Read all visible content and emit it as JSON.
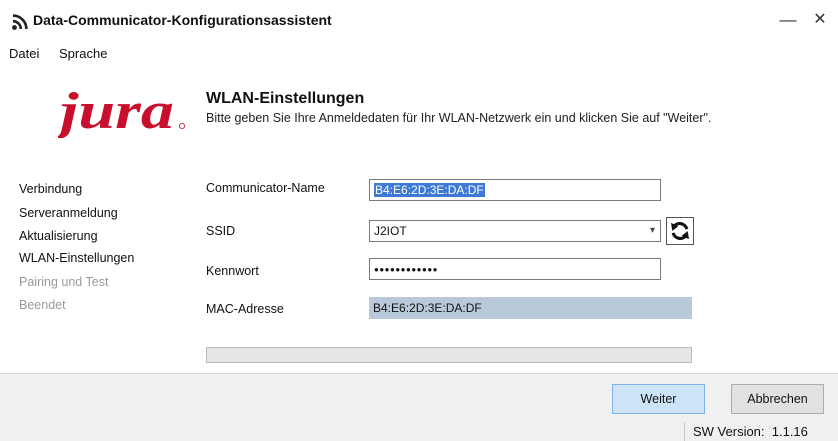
{
  "window": {
    "title": "Data-Communicator-Konfigurationsassistent",
    "minimize_glyph": "—",
    "close_glyph": "✕"
  },
  "menu": {
    "items": [
      {
        "label": "Datei"
      },
      {
        "label": "Sprache"
      }
    ]
  },
  "logo": {
    "text": "jura",
    "color": "#c8102e"
  },
  "header": {
    "title": "WLAN-Einstellungen",
    "subtitle": "Bitte geben Sie Ihre Anmeldedaten für Ihr WLAN-Netzwerk ein und klicken Sie auf \"Weiter\"."
  },
  "steps": [
    {
      "label": "Verbindung",
      "state": "done"
    },
    {
      "label": "Serveranmeldung",
      "state": "done"
    },
    {
      "label": "Aktualisierung",
      "state": "done"
    },
    {
      "label": "WLAN-Einstellungen",
      "state": "current"
    },
    {
      "label": "Pairing und Test",
      "state": "pending"
    },
    {
      "label": "Beendet",
      "state": "pending"
    }
  ],
  "form": {
    "name_label": "Communicator-Name",
    "name_value": "B4:E6:2D:3E:DA:DF",
    "ssid_label": "SSID",
    "ssid_value": "J2IOT",
    "password_label": "Kennwort",
    "password_value": "●●●●●●●●●●●●",
    "mac_label": "MAC-Adresse",
    "mac_value": "B4:E6:2D:3E:DA:DF"
  },
  "icons": {
    "app": "wifi-signal-icon",
    "refresh": "refresh-icon",
    "dropdown": "chevron-down-icon"
  },
  "progress": {
    "value": 0
  },
  "buttons": {
    "next_label": "Weiter",
    "cancel_label": "Abbrechen"
  },
  "status": {
    "sw_version": "SW Version:  1.1.16"
  },
  "colors": {
    "accent": "#3d79d5",
    "primary_button": "#cde3f7",
    "readonly_field": "#b9c9da",
    "logo_red": "#c8102e"
  }
}
